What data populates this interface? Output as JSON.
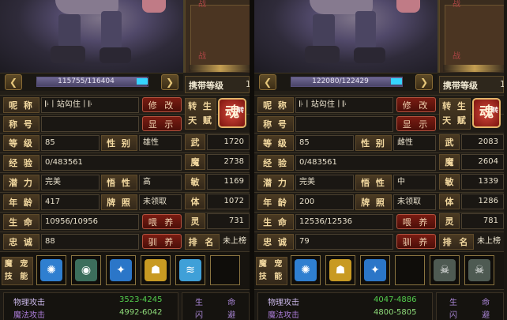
{
  "panels": [
    {
      "hp_text": "115755/116404",
      "hp_fraction": 0.994,
      "battle_labels": [
        "战",
        "战"
      ],
      "carry_label": "携带等级",
      "carry_value": "1",
      "name_label": "呢 称",
      "name_value": "𝄆丨站匃住丨𝄆",
      "edit_button": "修 改",
      "title_label": "称 号",
      "title_value": "",
      "show_button": "显 示",
      "level_label": "等 级",
      "level_value": "85",
      "gender_label": "性 别",
      "gender_value": "雄性",
      "exp_label": "经 验",
      "exp_value": "0/483561",
      "potential_label": "潜 力",
      "potential_value": "完美",
      "wisdom_label": "悟 性",
      "wisdom_value": "高",
      "age_label": "年 龄",
      "age_value": "417",
      "license_label": "牌 照",
      "license_value": "未领取",
      "life_label": "生 命",
      "life_value": "10956/10956",
      "feed_button": "喂 养",
      "loyalty_label": "忠 诚",
      "loyalty_value": "88",
      "tame_button": "驯 养",
      "attributes": [
        {
          "label": "武",
          "value": "1720"
        },
        {
          "label": "魔",
          "value": "2738"
        },
        {
          "label": "敏",
          "value": "1169"
        },
        {
          "label": "体",
          "value": "1072"
        },
        {
          "label": "灵",
          "value": "731"
        }
      ],
      "rebirth_label": "转 生 天 赋",
      "soul_label": "魂",
      "soul_badge": "转",
      "rank_label": "排 名",
      "rank_value": "未上榜",
      "skills_label": "魔 宠 技 能",
      "skills": [
        {
          "icon": "water-swirl-icon",
          "color": "#2f7fd0"
        },
        {
          "icon": "dark-eye-icon",
          "color": "#3c6e5c"
        },
        {
          "icon": "blue-claw-icon",
          "color": "#2b76c8"
        },
        {
          "icon": "gold-mask-icon",
          "color": "#c89a22"
        },
        {
          "icon": "wind-wave-icon",
          "color": "#3fa0d8"
        },
        {
          "icon": "empty-slot",
          "color": "#0f0d0a"
        }
      ],
      "stats": [
        {
          "name": "物理攻击",
          "value": "3523-4245"
        },
        {
          "name": "魔法攻击",
          "value": "4992-6042"
        }
      ],
      "side_stats": [
        "生 命",
        "闪 避"
      ]
    },
    {
      "hp_text": "122080/122429",
      "hp_fraction": 0.997,
      "battle_labels": [
        "战",
        "战"
      ],
      "carry_label": "携带等级",
      "carry_value": "1",
      "name_label": "呢 称",
      "name_value": "𝄆丨站匃住丨𝄆",
      "edit_button": "修 改",
      "title_label": "称 号",
      "title_value": "",
      "show_button": "显 示",
      "level_label": "等 级",
      "level_value": "85",
      "gender_label": "性 别",
      "gender_value": "雌性",
      "exp_label": "经 验",
      "exp_value": "0/483561",
      "potential_label": "潜 力",
      "potential_value": "完美",
      "wisdom_label": "悟 性",
      "wisdom_value": "中",
      "age_label": "年 龄",
      "age_value": "200",
      "license_label": "牌 照",
      "license_value": "未领取",
      "life_label": "生 命",
      "life_value": "12536/12536",
      "feed_button": "喂 养",
      "loyalty_label": "忠 诚",
      "loyalty_value": "79",
      "tame_button": "驯 养",
      "attributes": [
        {
          "label": "武",
          "value": "2083"
        },
        {
          "label": "魔",
          "value": "2604"
        },
        {
          "label": "敏",
          "value": "1339"
        },
        {
          "label": "体",
          "value": "1286"
        },
        {
          "label": "灵",
          "value": "781"
        }
      ],
      "rebirth_label": "转 生 天 赋",
      "soul_label": "魂",
      "soul_badge": "转",
      "rank_label": "排 名",
      "rank_value": "未上榜",
      "skills_label": "魔 宠 技 能",
      "skills": [
        {
          "icon": "water-swirl-icon",
          "color": "#2f7fd0"
        },
        {
          "icon": "gold-mask-icon",
          "color": "#c89a22"
        },
        {
          "icon": "blue-claw-icon",
          "color": "#2b76c8"
        },
        {
          "icon": "empty-slot",
          "color": "#0f0d0a"
        },
        {
          "icon": "stone-gargoyle-icon",
          "color": "#4e5a52"
        },
        {
          "icon": "stone-gargoyle-icon",
          "color": "#4e5a52"
        }
      ],
      "stats": [
        {
          "name": "物理攻击",
          "value": "4047-4886"
        },
        {
          "name": "魔法攻击",
          "value": "4800-5805"
        }
      ],
      "side_stats": [
        "生 命",
        "闪 避"
      ]
    }
  ]
}
